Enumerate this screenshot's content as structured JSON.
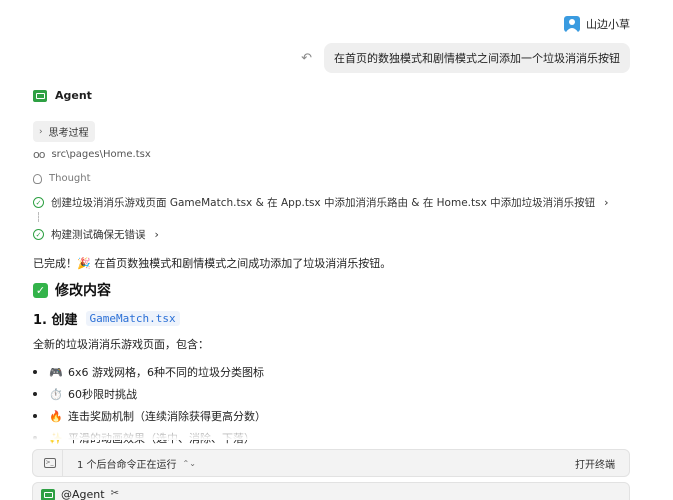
{
  "user": {
    "name": "山边小草",
    "message": "在首页的数独模式和剧情模式之间添加一个垃圾消消乐按钮"
  },
  "agent": {
    "name": "Agent",
    "think_label": "思考过程",
    "file_ref": "src\\pages\\Home.tsx",
    "thought_label": "Thought",
    "tasks": [
      "创建垃圾消消乐游戏页面 GameMatch.tsx & 在 App.tsx 中添加消消乐路由 & 在 Home.tsx 中添加垃圾消消乐按钮",
      "构建测试确保无错误"
    ],
    "done_text": "已完成！🎉 在首页数独模式和剧情模式之间成功添加了垃圾消消乐按钮。",
    "section_title": "修改内容",
    "sub_title": "1. 创建",
    "sub_code": "GameMatch.tsx",
    "description": "全新的垃圾消消乐游戏页面，包含：",
    "bullets": [
      {
        "emoji": "🎮",
        "text": "6x6 游戏网格，6种不同的垃圾分类图标"
      },
      {
        "emoji": "⏱️",
        "text": "60秒限时挑战"
      },
      {
        "emoji": "🔥",
        "text": "连击奖励机制（连续消除获得更高分数）"
      },
      {
        "emoji": "✨",
        "text": "平滑的动画效果（选中、消除、下落）"
      }
    ]
  },
  "command_bar": {
    "status": "1 个后台命令正在运行",
    "open_terminal": "打开终端"
  },
  "input": {
    "mention": "@Agent"
  },
  "colors": {
    "accent_green": "#2ea043",
    "code_blue": "#2a6fd6",
    "user_avatar": "#3a9be0"
  }
}
